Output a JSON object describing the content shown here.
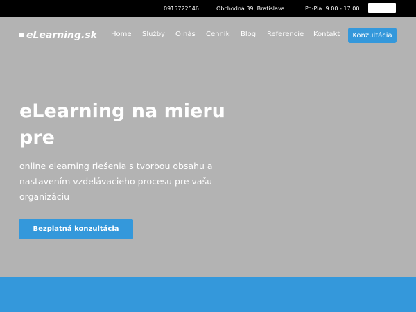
{
  "topbar": {
    "phone": "0915722546",
    "address": "Obchodná 39, Bratislava",
    "hours": "Po-Pia: 9:00 - 17:00"
  },
  "header": {
    "logo_text": "eLearning.sk",
    "nav": [
      {
        "label": "Home"
      },
      {
        "label": "Služby"
      },
      {
        "label": "O nás"
      },
      {
        "label": "Cenník"
      },
      {
        "label": "Blog"
      },
      {
        "label": "Referencie"
      },
      {
        "label": "Kontakt"
      }
    ],
    "cta_label": "Konzultácia"
  },
  "hero": {
    "title": "eLearning na mieru pre",
    "subtitle": "online elearning riešenia s tvorbou obsahu a nastavením vzdelávacieho procesu pre vašu organizáciu",
    "button_label": "Bezplatná konzultácia"
  },
  "colors": {
    "accent": "#3498db",
    "hero_bg": "#b3b3b3",
    "topbar_bg": "#000000"
  }
}
